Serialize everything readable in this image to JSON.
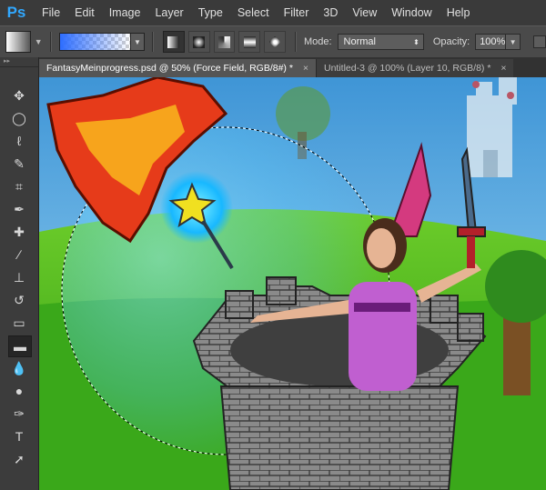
{
  "app": {
    "logo": "Ps"
  },
  "menu": [
    {
      "label": "File",
      "key": "F",
      "rest": "ile"
    },
    {
      "label": "Edit",
      "key": "E",
      "rest": "dit"
    },
    {
      "label": "Image",
      "key": "I",
      "rest": "mage"
    },
    {
      "label": "Layer",
      "key": "L",
      "rest": "ayer"
    },
    {
      "label": "Type",
      "key": "T",
      "rest": "ype"
    },
    {
      "label": "Select",
      "key": "S",
      "rest": "elect"
    },
    {
      "label": "Filter",
      "key": "T",
      "pre": "Fil",
      "rest": "er"
    },
    {
      "label": "3D",
      "key": "3",
      "rest": "D"
    },
    {
      "label": "View",
      "key": "V",
      "rest": "iew"
    },
    {
      "label": "Window",
      "key": "W",
      "rest": "indow"
    },
    {
      "label": "Help",
      "key": "H",
      "rest": "elp"
    }
  ],
  "options": {
    "mode_label": "Mode:",
    "mode_value": "Normal",
    "opacity_label": "Opacity:",
    "opacity_value": "100%",
    "gradient_types": [
      "linear",
      "radial",
      "angle",
      "reflected",
      "diamond"
    ],
    "active_gradient_type": "linear"
  },
  "tabs": [
    {
      "label": "FantasyMeinprogress.psd @ 50% (Force Field, RGB/8#) *",
      "active": true
    },
    {
      "label": "Untitled-3 @ 100% (Layer 10, RGB/8) *",
      "active": false
    }
  ],
  "tools": [
    "move-tool-icon",
    "marquee-tool-icon",
    "lasso-tool-icon",
    "quick-select-tool-icon",
    "crop-tool-icon",
    "eyedropper-tool-icon",
    "spot-healing-tool-icon",
    "brush-tool-icon",
    "clone-stamp-tool-icon",
    "history-brush-tool-icon",
    "eraser-tool-icon",
    "gradient-tool-icon",
    "blur-tool-icon",
    "dodge-tool-icon",
    "pen-tool-icon",
    "type-tool-icon",
    "path-select-tool-icon"
  ],
  "tool_glyphs": [
    "✥",
    "◯",
    "ℓ",
    "✎",
    "⌗",
    "✒",
    "✚",
    "∕",
    "⊥",
    "↺",
    "▭",
    "▬",
    "💧",
    "●",
    "✑",
    "T",
    "➚"
  ],
  "active_tool": "gradient-tool-icon",
  "colors": {
    "accent": "#31a8ff",
    "sky_top": "#4fa3d9",
    "grass": "#3fae1e",
    "forcefield": "#5fcfff"
  }
}
